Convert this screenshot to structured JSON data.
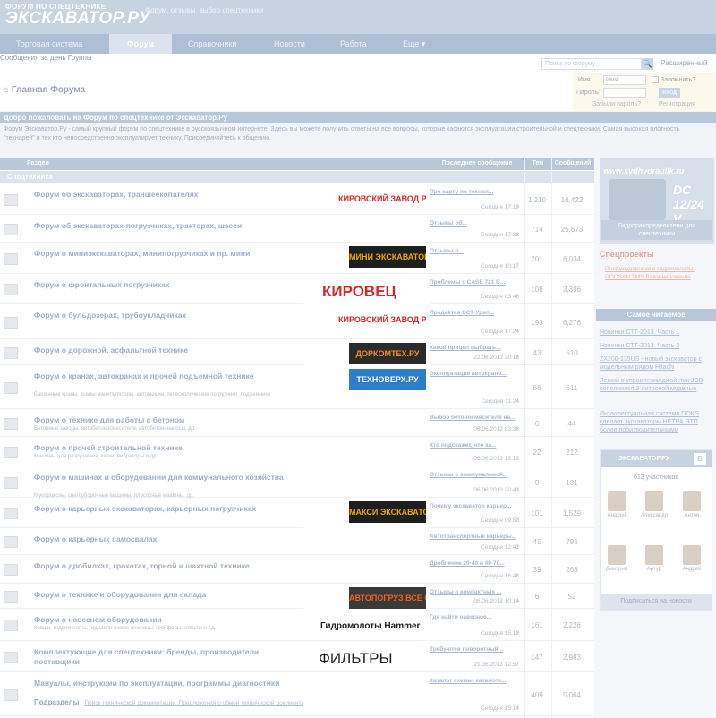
{
  "header": {
    "logo_top": "ФОРУМ ПО СПЕЦТЕХНИКЕ",
    "logo_main": "ЭКСКАВАТОР.РУ",
    "tagline": "Форум, отзывы, выбор спецтехники"
  },
  "nav": [
    {
      "label": "Торговая система"
    },
    {
      "label": "Форум"
    },
    {
      "label": "Справочники"
    },
    {
      "label": "Новости"
    },
    {
      "label": "Работа"
    },
    {
      "label": "Еще ▾"
    }
  ],
  "subnav": {
    "messages": "Сообщения за день",
    "groups": "Группы",
    "search_placeholder": "Поиск по форуму",
    "advanced": "Расширенный"
  },
  "page": {
    "title": "Главная Форума"
  },
  "login": {
    "name_label": "Имя",
    "name_placeholder": "Имя",
    "remember": "Запомнить?",
    "password_label": "Пароль",
    "button": "Вход",
    "forgot": "Забыли пароль?",
    "register": "Регистрация"
  },
  "welcome": "Добро пожаловать на Форум по спецтехнике от Экскаватор.Ру",
  "intro": "Форум Экскаватор.Ру - самый крупный форум по спецтехнике в русскоязычном интернете. Здесь вы можете получить ответы на все вопросы, которые касаются эксплуатации строительной и спецтехники. Самая высокая плотность \"технарей\" и тех кто непосредственно эксплуатирует технику. Присоединяйтесь к общению.",
  "table": {
    "col_section": "Раздел",
    "col_last": "Последнее сообщение",
    "col_topics": "Тем",
    "col_messages": "Сообщений",
    "category": "Спецтехника"
  },
  "forums": [
    {
      "title": "Форум об экскаваторах, траншеекопателях",
      "desc": "",
      "logo": "КИРОВСКИЙ ЗАВОД POWERPLUS",
      "last": "Про карту по технол...",
      "date": "Сегодня 17:19",
      "topics": "1,210",
      "messages": "16,422"
    },
    {
      "title": "Форум об экскаваторах-погрузчиках, тракторах, шасси",
      "desc": "",
      "logo": "",
      "last": "Отзывы об...",
      "date": "Сегодня 17:38",
      "topics": "714",
      "messages": "25,673"
    },
    {
      "title": "Форум о миниэкскаваторах, минипогрузчиках и пр. мини",
      "desc": "",
      "logo": "МИНИ ЭКСКАВАТОР.РУ",
      "last": "Отзывы о...",
      "date": "Сегодня 10:17",
      "topics": "201",
      "messages": "6,034"
    },
    {
      "title": "Форум о фронтальных погрузчиках",
      "desc": "",
      "logo": "КИРОВЕЦ",
      "last": "Проблемы с CASE 721 В...",
      "date": "Сегодня 03:46",
      "topics": "108",
      "messages": "3,396"
    },
    {
      "title": "Форум о бульдозерах, трубоукладчиках",
      "desc": "",
      "logo": "КИРОВСКИЙ ЗАВОД POWERPLUS",
      "last": "Продаётся ВСТ-Урал...",
      "date": "Сегодня 17:24",
      "topics": "193",
      "messages": "6,276"
    },
    {
      "title": "Форум о дорожной, асфальтной технике",
      "desc": "",
      "logo": "ДОРКОМТЕХ.РУ",
      "last": "Какой прицеп выбрать...",
      "date": "22.06.2013 20:16",
      "topics": "43",
      "messages": "510"
    },
    {
      "title": "Форум о кранах, автокранах и прочей подъемной технике",
      "desc": "Башенные краны, краны-манипуляторы, автовышки, телескопические погрузчики, подъемники",
      "logo": "ТЕХНОВЕРХ.РУ",
      "last": "Эксплуатация автокрано...",
      "date": "Сегодня 11:24",
      "topics": "66",
      "messages": "611"
    },
    {
      "title": "Форум о технике для работы с бетоном",
      "desc": "Бетонные заводы, автобетоносмесители, автобетононасосы, др.",
      "logo": "",
      "last": "Выбор бетоносмесителя на...",
      "date": "06.06.2013 03:38",
      "topics": "6",
      "messages": "44"
    },
    {
      "title": "Форум о прочей строительной технике",
      "desc": "Машины для разрушения, катки, вибраторы и др.",
      "logo": "",
      "last": "Кто подскажет, что за...",
      "date": "06.06.2013 13:12",
      "topics": "22",
      "messages": "212"
    },
    {
      "title": "Форум о машинах и оборудовании для коммунального хозяйства",
      "desc": "Мусоровозы, снегоуборочные машины, илососные машины, др.",
      "logo": "",
      "last": "Отзывы о коммунальной...",
      "date": "06.06.2013 20:43",
      "topics": "9",
      "messages": "131"
    },
    {
      "title": "Форум о карьерных экскаваторах, карьерных погрузчиках",
      "desc": "",
      "logo": "МАКСИ ЭКСКАВАТОР.РУ",
      "last": "Почему экскаватор карьер...",
      "date": "Сегодня 09:50",
      "topics": "101",
      "messages": "1,529"
    },
    {
      "title": "Форум о карьерных самосвалах",
      "desc": "",
      "logo": "",
      "last": "Автотранспортные карьеры...",
      "date": "Сегодня 12:42",
      "topics": "45",
      "messages": "796"
    },
    {
      "title": "Форум о дробилках, грохотах, горной и шахтной технике",
      "desc": "",
      "logo": "",
      "last": "Дробление 20-40 и 40-70...",
      "date": "Сегодня 16:46",
      "topics": "39",
      "messages": "263"
    },
    {
      "title": "Форум о технике и оборудовании для склада",
      "desc": "",
      "logo": "АВТОПОГРУЗ ВСЕ О СКЛАДСКОЙ ТЕХНИКЕ",
      "last": "Отзывы о компактных ...",
      "date": "06.06.2013 10:14",
      "topics": "6",
      "messages": "52"
    },
    {
      "title": "Форум о навесном оборудовании",
      "desc": "Ковши, гидромолоты, гидравлические ножницы, грейферы, отвалы и т.д.",
      "logo": "Гидромолоты Hammer",
      "last": "Где найти навесное...",
      "date": "Сегодня 15:19",
      "topics": "161",
      "messages": "2,226"
    },
    {
      "title": "Комплектующие для спецтехники: бренды, производители, поставщики",
      "desc": "",
      "logo": "ФИЛЬТРЫ",
      "last": "Требуются поворотный...",
      "date": "21.06.2013 12:57",
      "topics": "147",
      "messages": "2,983"
    },
    {
      "title": "Мануалы, инструкции по эксплуатации, программы диагностики",
      "desc": "",
      "logo": "",
      "last": "Каталог схемы, каталоги...",
      "date": "Сегодня 15:14",
      "topics": "409",
      "messages": "5,064"
    }
  ],
  "subforums": {
    "label": "Подразделы",
    "links": "Поиск технической документации, Предложения о обмен технической документацией"
  },
  "sidebar": {
    "banner_url": "www.svdhydraulik.ru",
    "banner_title": "DC 12/24 V",
    "banner_caption": "Гидрораспределители для спецтехники",
    "projects_title": "Спецпроекты",
    "projects_links": "Пневмоударники и гидромолоты. DOOSAN TMS Вакцинирование",
    "most_read_title": "Самое читаемое",
    "most_read": [
      "Новинки СТТ-2013. Часть 1",
      "Новинки СТТ-2013. Часть 2",
      "ZX200-135US - новый экскаватор с модельным рядом Hitachi",
      "Легкий в управлении джойстик JCB пополнился 3-литровой моделью",
      "Интеллектуальная система DOKS сделает экскаваторы НЕТРА ЭТП более производительными"
    ],
    "vk_title": "ЭКСКАВАТОР.РУ",
    "vk_count": "613 участников",
    "vk_members": [
      "Андрей",
      "Александр",
      "Антон",
      "Дмитрий",
      "Артур",
      "Андрей"
    ],
    "vk_button": "Подписаться на новости"
  },
  "colors": {
    "accent": "#b9c7da",
    "header": "#c8d3e2",
    "link": "#9fb0c8"
  }
}
